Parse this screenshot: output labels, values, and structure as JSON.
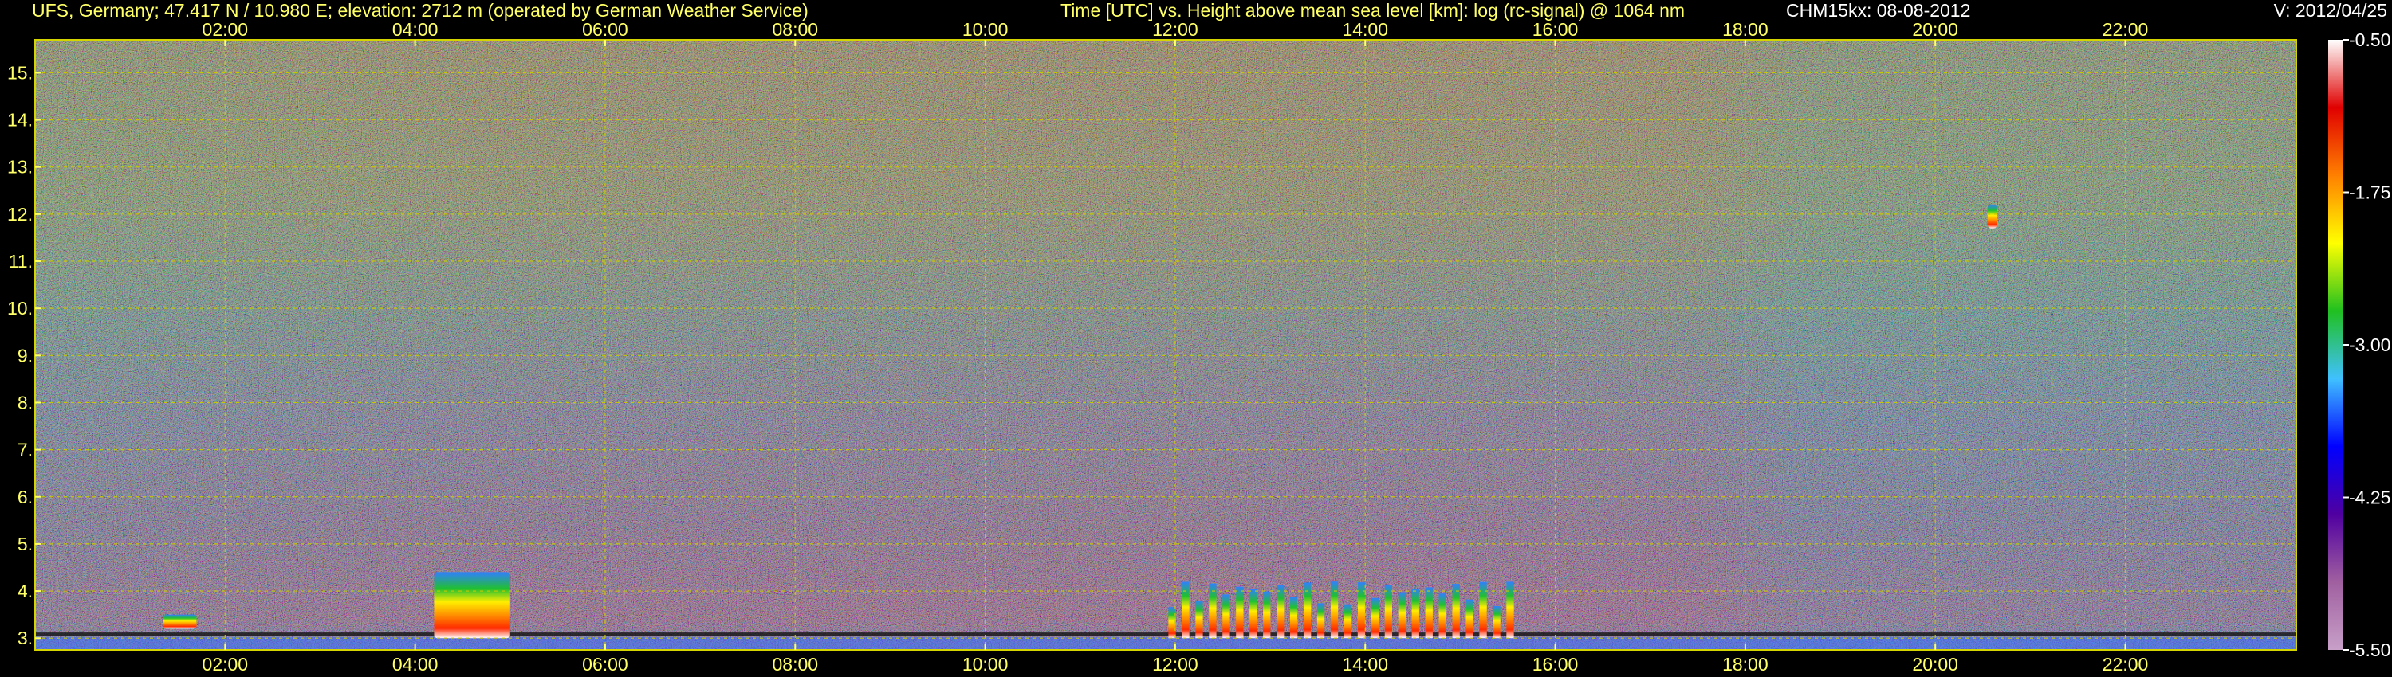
{
  "header": {
    "station": "UFS, Germany; 47.417 N / 10.980 E; elevation: 2712 m  (operated by German Weather Service)",
    "plot_title": "Time [UTC] vs. Height above mean sea level [km]: log (rc-signal) @ 1064 nm",
    "instrument_date": "CHM15kx: 08-08-2012",
    "version": "V: 2012/04/25"
  },
  "colors": {
    "background": "#000000",
    "text": "#ffff66",
    "frame": "#d4d400",
    "grid": "#c8c800",
    "instrument_text": "#ffffff"
  },
  "chart_data": {
    "type": "heatmap",
    "title": "Time [UTC] vs. Height above mean sea level [km]: log (rc-signal) @ 1064 nm",
    "xlabel": "Time [UTC]",
    "ylabel": "Height above mean sea level [km]",
    "x_ticks": [
      "02:00",
      "04:00",
      "06:00",
      "08:00",
      "10:00",
      "12:00",
      "14:00",
      "16:00",
      "18:00",
      "20:00",
      "22:00"
    ],
    "x_tick_hours": [
      2,
      4,
      6,
      8,
      10,
      12,
      14,
      16,
      18,
      20,
      22
    ],
    "xlim_hours": [
      0,
      23.8
    ],
    "y_ticks": [
      "3.",
      "4.",
      "5.",
      "6.",
      "7.",
      "8.",
      "9.",
      "10.",
      "11.",
      "12.",
      "13.",
      "14.",
      "15."
    ],
    "y_tick_values": [
      3,
      4,
      5,
      6,
      7,
      8,
      9,
      10,
      11,
      12,
      13,
      14,
      15
    ],
    "ylim": [
      2.75,
      15.7
    ],
    "grid": true,
    "colorbar": {
      "labels": [
        "-0.50",
        "-1.75",
        "-3.00",
        "-4.25",
        "-5.50"
      ],
      "values": [
        -0.5,
        -1.75,
        -3.0,
        -4.25,
        -5.5
      ],
      "range": [
        -5.5,
        -0.5
      ],
      "colors": [
        "#ffffff",
        "#e00000",
        "#ff8000",
        "#ffff00",
        "#20c020",
        "#40c0ff",
        "#0000ff",
        "#5000a0",
        "#a060a0",
        "#c8a0c8"
      ]
    },
    "features": [
      {
        "name": "low clouds",
        "t_start": 4.2,
        "t_end": 5.0,
        "h_bottom": 3.0,
        "h_top": 4.4
      },
      {
        "name": "low clouds",
        "t_start": 11.9,
        "t_end": 15.6,
        "h_bottom": 3.0,
        "h_top": 4.2
      },
      {
        "name": "low clouds",
        "t_start": 1.35,
        "t_end": 1.7,
        "h_bottom": 3.2,
        "h_top": 3.5
      },
      {
        "name": "cloud",
        "t_start": 20.55,
        "t_end": 20.65,
        "h_bottom": 11.7,
        "h_top": 12.2
      }
    ]
  }
}
